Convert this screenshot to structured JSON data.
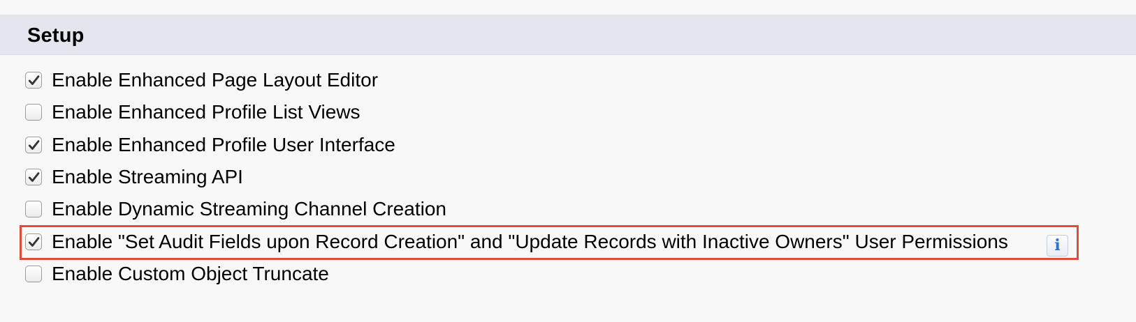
{
  "section": {
    "title": "Setup"
  },
  "options": [
    {
      "label": "Enable Enhanced Page Layout Editor",
      "checked": true
    },
    {
      "label": "Enable Enhanced Profile List Views",
      "checked": false
    },
    {
      "label": "Enable Enhanced Profile User Interface",
      "checked": true
    },
    {
      "label": "Enable Streaming API",
      "checked": true
    },
    {
      "label": "Enable Dynamic Streaming Channel Creation",
      "checked": false
    },
    {
      "label": "Enable \"Set Audit Fields upon Record Creation\" and \"Update Records with Inactive Owners\" User Permissions",
      "checked": true,
      "highlighted": true,
      "info_icon": "info-icon"
    },
    {
      "label": "Enable Custom Object Truncate",
      "checked": false
    }
  ],
  "colors": {
    "header_background": "#e3e6ee",
    "highlight_border": "#e24b35",
    "info_icon": "#2f6fd6"
  },
  "info": {
    "letter": "i"
  }
}
